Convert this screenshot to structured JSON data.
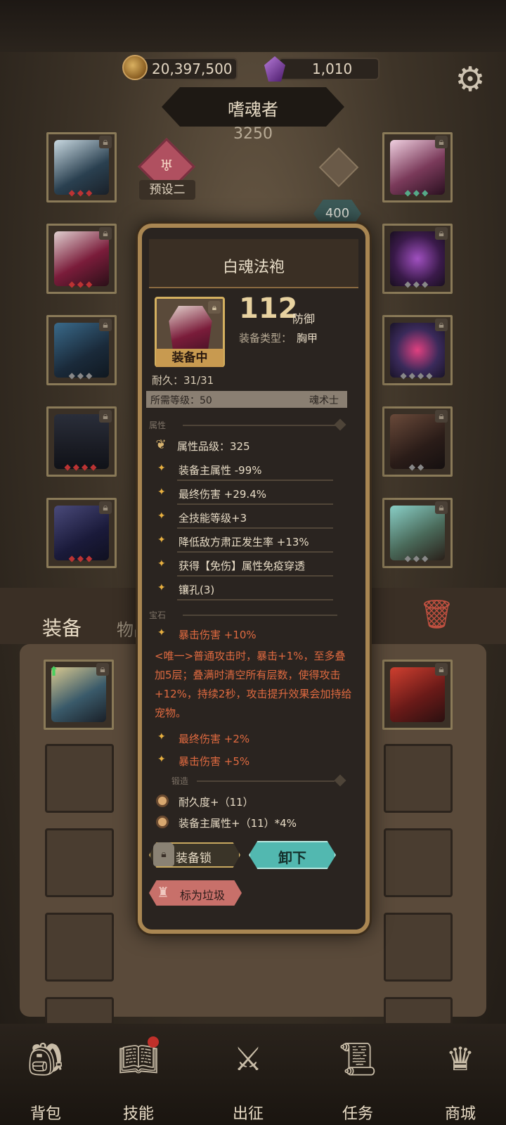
{
  "currency": {
    "gold": "20,397,500",
    "gems": "1,010"
  },
  "character": {
    "name": "嗜魂者",
    "power": "3250",
    "preset": "预设二",
    "level": "400"
  },
  "tooltip": {
    "item_name": "白魂法袍",
    "equipped_tag": "装备中",
    "defense_value": "112",
    "defense_label": "防御",
    "type_label": "装备类型：",
    "type_value": "胸甲",
    "durability": "耐久：31/31",
    "req_level": "所需等级：50",
    "req_class": "魂术士",
    "section_attr": "属性",
    "quality": "属性品级：325",
    "affixes": [
      "装备主属性 -99%",
      "最终伤害 +29.4%",
      "全技能等级+3",
      "降低敌方肃正发生率 +13%",
      "获得【免伤】属性免疫穿透",
      "镶孔(3)"
    ],
    "section_gem": "宝石",
    "gem_main": "暴击伤害 +10%",
    "gem_desc": "<唯一>普通攻击时，暴击+1%，至多叠加5层；叠满时清空所有层数，使得攻击+12%，持续2秒，攻击提升效果会加持给宠物。",
    "gem_extra": [
      "最终伤害 +2%",
      "暴击伤害 +5%"
    ],
    "section_forge": "锻造",
    "forge": [
      "耐久度+（11）",
      "装备主属性+（11）*4%"
    ],
    "btn_lock": "装备锁",
    "btn_unequip": "卸下",
    "btn_junk": "标为垃圾"
  },
  "tabs": {
    "equip": "装备",
    "items": "物品"
  },
  "nav": [
    "背包",
    "技能",
    "出征",
    "任务",
    "商城"
  ],
  "colors": {
    "accent_gold": "#a98652",
    "affix_red": "#e06a40",
    "teal_button": "#52b8b0"
  }
}
